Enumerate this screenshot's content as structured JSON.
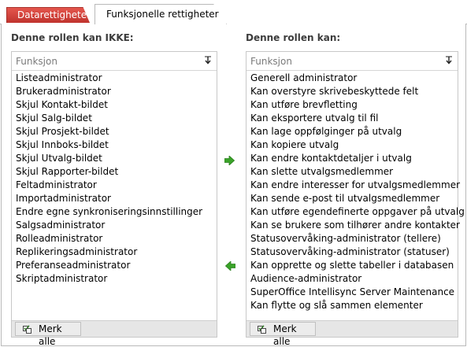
{
  "tabs": [
    {
      "label": "Datarettigheter",
      "active": false
    },
    {
      "label": "Funksjonelle rettigheter",
      "active": true
    }
  ],
  "left": {
    "title": "Denne rollen kan IKKE:",
    "header": "Funksjon",
    "items": [
      "Listeadministrator",
      "Brukeradministrator",
      "Skjul Kontakt-bildet",
      "Skjul Salg-bildet",
      "Skjul Prosjekt-bildet",
      "Skjul Innboks-bildet",
      "Skjul Utvalg-bildet",
      "Skjul Rapporter-bildet",
      "Feltadministrator",
      "Importadministrator",
      "Endre egne synkroniseringsinnstillinger",
      "Salgsadministrator",
      "Rolleadministrator",
      "Replikeringsadministrator",
      "Preferanseadministrator",
      "Skriptadministrator"
    ],
    "select_all": "Merk alle"
  },
  "right": {
    "title": "Denne rollen kan:",
    "header": "Funksjon",
    "items": [
      "Generell administrator",
      "Kan overstyre skrivebeskyttede felt",
      "Kan utføre brevfletting",
      "Kan eksportere utvalg til fil",
      "Kan lage oppfølginger på utvalg",
      "Kan kopiere utvalg",
      "Kan endre kontaktdetaljer i utvalg",
      "Kan slette utvalgsmedlemmer",
      "Kan endre interesser for utvalgsmedlemmer",
      "Kan sende e-post til utvalgsmedlemmer",
      "Kan utføre egendefinerte oppgaver på utvalg",
      "Kan se brukere som tilhører andre kontakter",
      "Statusovervåking-administrator (tellere)",
      "Statusovervåking-administrator (statuser)",
      "Kan opprette og slette tabeller i databasen",
      "Audience-administrator",
      "SuperOffice Intellisync Server Maintenance",
      "Kan flytte og slå sammen elementer"
    ],
    "select_all": "Merk alle"
  },
  "icons": {
    "move_right": "arrow-right-icon",
    "move_left": "arrow-left-icon",
    "sort": "sort-down-icon",
    "select_all": "checkbox-list-icon"
  },
  "colors": {
    "tab_inactive": "#d2433c",
    "arrow_green": "#3aa329"
  }
}
